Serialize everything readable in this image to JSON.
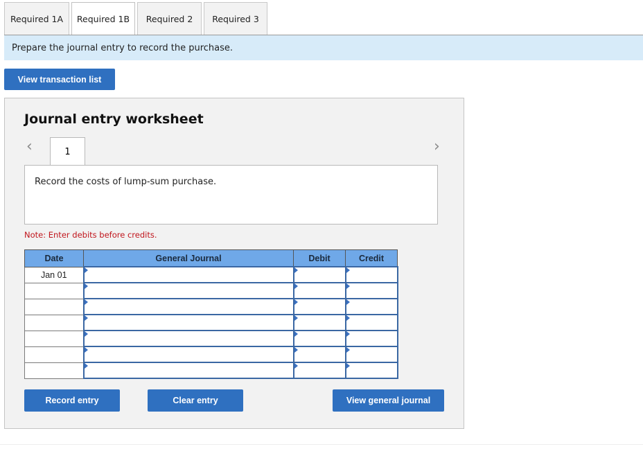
{
  "tabs": [
    {
      "label": "Required 1A",
      "active": false
    },
    {
      "label": "Required 1B",
      "active": true
    },
    {
      "label": "Required 2",
      "active": false
    },
    {
      "label": "Required 3",
      "active": false
    }
  ],
  "prompt": "Prepare the journal entry to record the purchase.",
  "view_transaction_list": "View transaction list",
  "worksheet": {
    "title": "Journal entry worksheet",
    "prev_icon": "chevron-left-icon",
    "next_icon": "chevron-right-icon",
    "prev_glyph": "‹",
    "next_glyph": "›",
    "current_page": "1",
    "description": "Record the costs of lump-sum purchase.",
    "note": "Note: Enter debits before credits.",
    "columns": [
      "Date",
      "General Journal",
      "Debit",
      "Credit"
    ],
    "rows": [
      {
        "date": "Jan 01",
        "account": "",
        "debit": "",
        "credit": ""
      },
      {
        "date": "",
        "account": "",
        "debit": "",
        "credit": ""
      },
      {
        "date": "",
        "account": "",
        "debit": "",
        "credit": ""
      },
      {
        "date": "",
        "account": "",
        "debit": "",
        "credit": ""
      },
      {
        "date": "",
        "account": "",
        "debit": "",
        "credit": ""
      },
      {
        "date": "",
        "account": "",
        "debit": "",
        "credit": ""
      },
      {
        "date": "",
        "account": "",
        "debit": "",
        "credit": ""
      }
    ],
    "buttons": {
      "record": "Record entry",
      "clear": "Clear entry",
      "view_journal": "View general journal"
    }
  },
  "colors": {
    "accent": "#2f70c0",
    "prompt_bg": "#d7ebf9",
    "header_bg": "#6fa8e8",
    "note": "#c0141b"
  }
}
